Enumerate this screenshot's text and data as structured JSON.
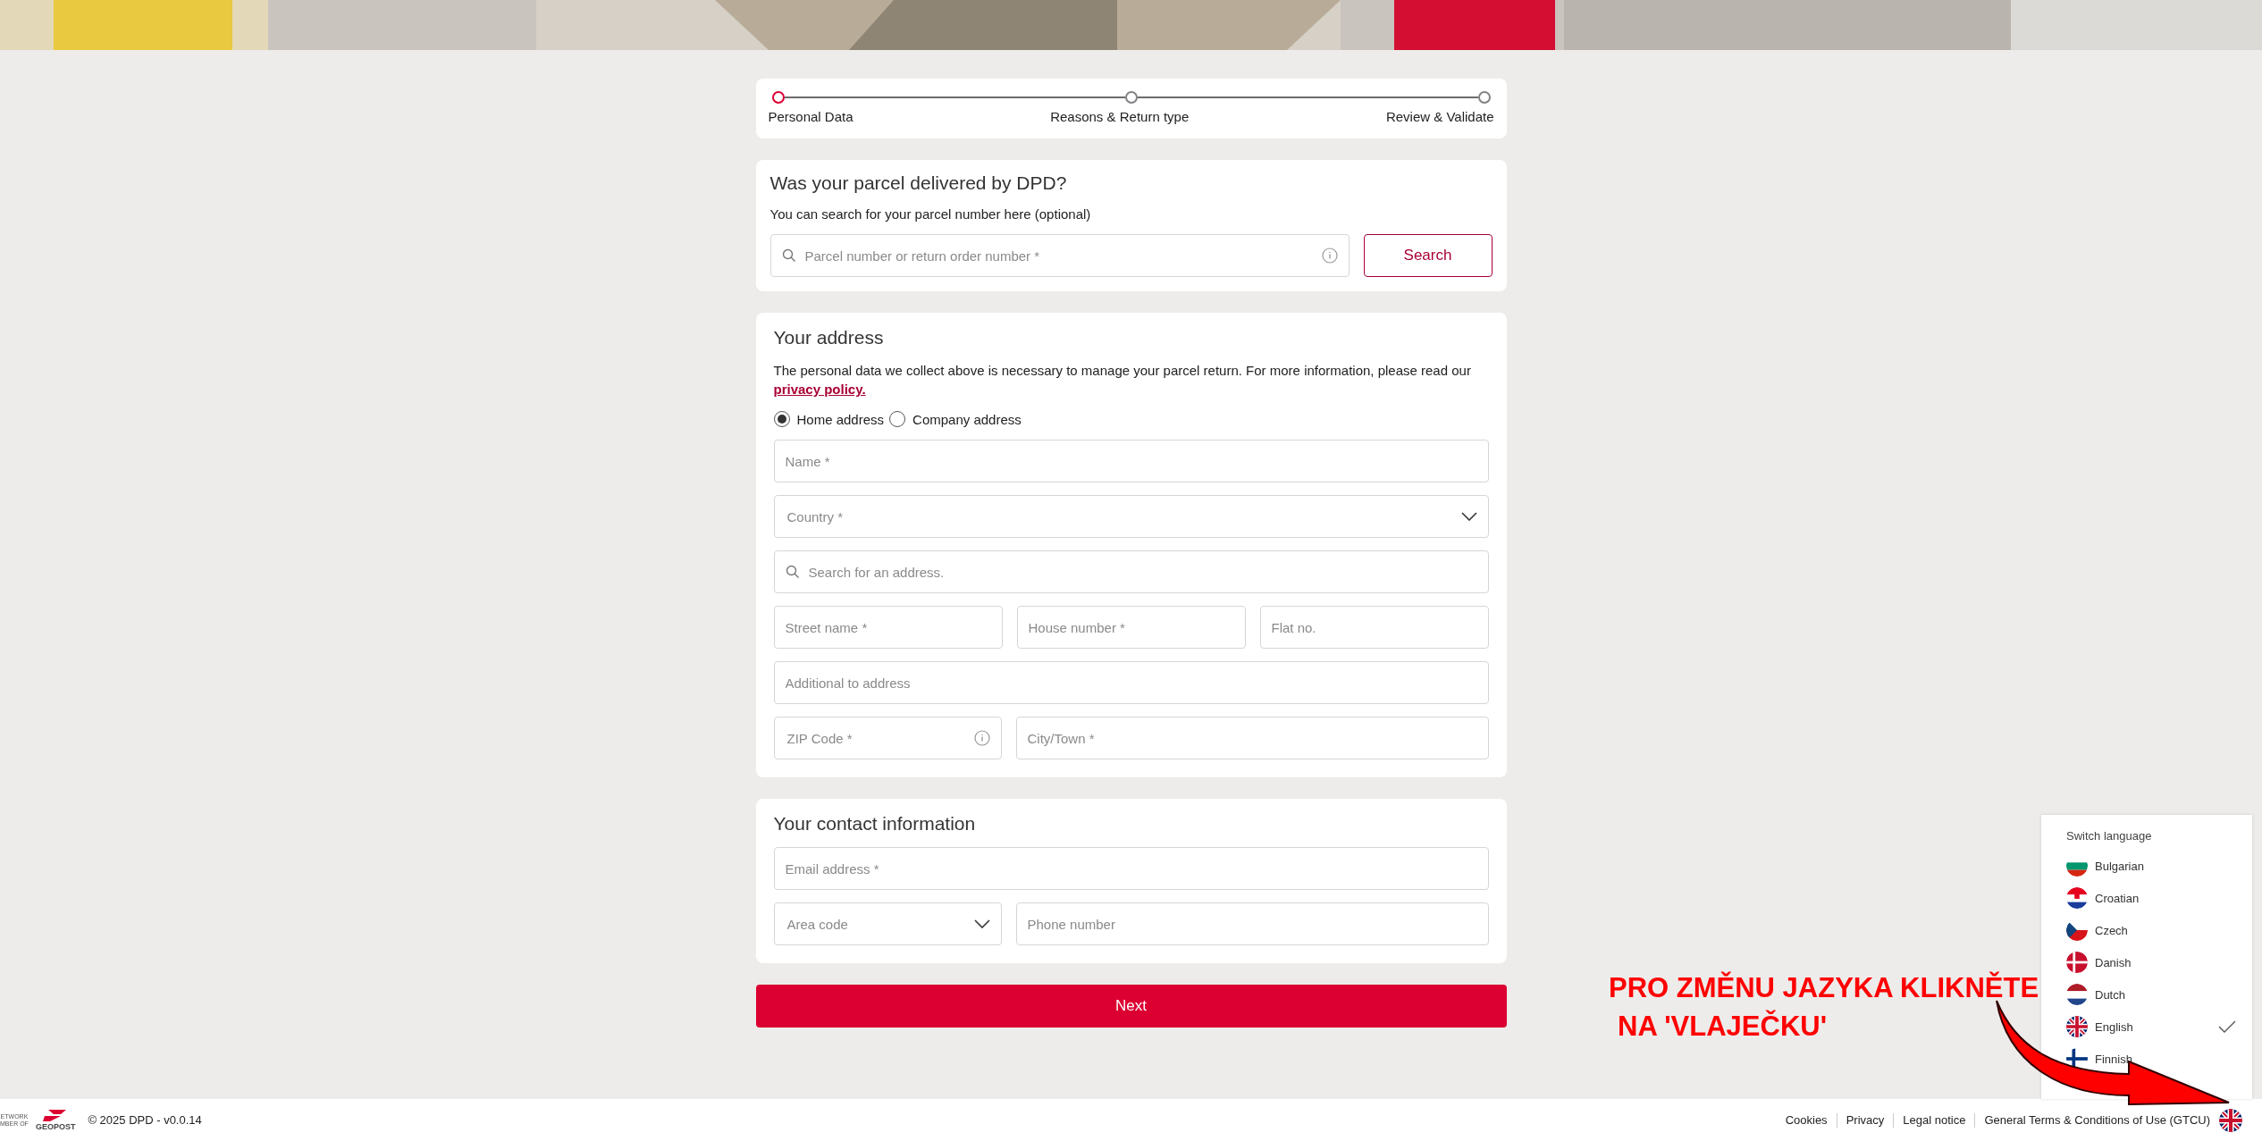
{
  "stepper": {
    "steps": [
      {
        "label": "Personal Data",
        "selected": true
      },
      {
        "label": "Reasons & Return type",
        "selected": false
      },
      {
        "label": "Review & Validate",
        "selected": false
      }
    ]
  },
  "parcel_search": {
    "title": "Was your parcel delivered by DPD?",
    "hint": "You can search for your parcel number here (optional)",
    "field": {
      "placeholder": "Parcel number or return order number *"
    },
    "button": "Search"
  },
  "address": {
    "title": "Your address",
    "notice": "The personal data we collect above is necessary to manage your parcel return. For more information, please read our",
    "link": "privacy policy.",
    "address_types": [
      {
        "label": "Home address",
        "selected": true
      },
      {
        "label": "Company address",
        "selected": false
      }
    ],
    "rows": [
      [
        {
          "kind": "text",
          "placeholder": "Name *"
        }
      ],
      [
        {
          "kind": "select",
          "placeholder": "Country *"
        }
      ],
      [
        {
          "kind": "search",
          "placeholder": "Search for an address."
        }
      ],
      [
        {
          "kind": "text",
          "placeholder": "Street name *"
        },
        {
          "kind": "text",
          "placeholder": "House number *"
        },
        {
          "kind": "text",
          "placeholder": "Flat no."
        }
      ],
      [
        {
          "kind": "text",
          "placeholder": "Additional to address"
        }
      ],
      [
        {
          "kind": "info",
          "placeholder": "ZIP Code *"
        },
        {
          "kind": "text",
          "placeholder": "City/Town *"
        }
      ]
    ]
  },
  "contact": {
    "title": "Your contact information",
    "rows": [
      [
        {
          "kind": "text",
          "placeholder": "Email address *"
        }
      ],
      [
        {
          "kind": "select",
          "placeholder": "Area code"
        },
        {
          "kind": "text",
          "placeholder": "Phone number"
        }
      ]
    ]
  },
  "next_button": "Next",
  "footer": {
    "logo_lines": [
      "ETWORK",
      "MBER OF"
    ],
    "logo_name": "GEOPOST",
    "copyright": "© 2025 DPD - v0.0.14",
    "links": [
      "Cookies",
      "Privacy",
      "Legal notice",
      "General Terms & Conditions of Use (GTCU)"
    ]
  },
  "language_menu": {
    "title": "Switch language",
    "items": [
      {
        "label": "Bulgarian",
        "selected": false
      },
      {
        "label": "Croatian",
        "selected": false
      },
      {
        "label": "Czech",
        "selected": false
      },
      {
        "label": "Danish",
        "selected": false
      },
      {
        "label": "Dutch",
        "selected": false
      },
      {
        "label": "English",
        "selected": true
      },
      {
        "label": "Finnish",
        "selected": false
      }
    ]
  },
  "annotation": {
    "lines": [
      "PRO ZMĚNU JAZYKA KLIKNĚTE",
      "NA 'VLAJEČKU'"
    ]
  }
}
